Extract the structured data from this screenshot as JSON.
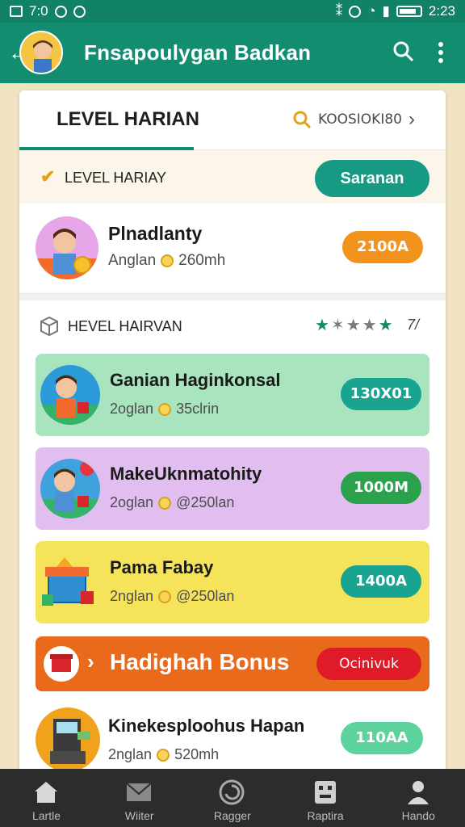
{
  "status_bar": {
    "time_left": "7:0",
    "time_right": "2:23"
  },
  "app_bar": {
    "title": "Fnsapoulygan Badkan"
  },
  "tabs": {
    "active": "LEVEL HARIAN",
    "search_text": "KOOSIOKI80"
  },
  "level_row": {
    "label": "LEVEL HARIAY",
    "button": "Saranan"
  },
  "profile_row": {
    "name": "Plnadlanty",
    "sub_prefix": "Anglan",
    "sub_suffix": "260mh",
    "pill": "2100A"
  },
  "section2": {
    "label": "HEVEL HAIRVAN",
    "rating": "7/"
  },
  "tasks": [
    {
      "name": "Ganian Haginkonsal",
      "sub_prefix": "2oglan",
      "sub_suffix": "35clrin",
      "pill": "130X01",
      "bg": "#a8e4be",
      "pill_color": "#18a491"
    },
    {
      "name": "MakeUknmatohity",
      "sub_prefix": "2oglan",
      "sub_suffix": "@250lan",
      "pill": "1000M",
      "bg": "#e1bdf0",
      "pill_color": "#2aa24b"
    },
    {
      "name": "Pama Fabay",
      "sub_prefix": "2nglan",
      "sub_suffix": "@250lan",
      "pill": "1400A",
      "bg": "#f5e45a",
      "pill_color": "#18a491"
    }
  ],
  "bonus": {
    "title": "Hadighah Bonus",
    "button": "Ocinivuk"
  },
  "last_row": {
    "name": "Kinekesploohus Hapan",
    "sub_prefix": "2nglan",
    "sub_suffix": "520mh",
    "pill": "110AA",
    "pill_color": "#5dd29d"
  },
  "bottom_nav": [
    {
      "label": "Lartle",
      "icon": "home-icon"
    },
    {
      "label": "Wiiter",
      "icon": "mail-icon"
    },
    {
      "label": "Ragger",
      "icon": "swirl-icon"
    },
    {
      "label": "Raptira",
      "icon": "robot-icon"
    },
    {
      "label": "Hando",
      "icon": "person-icon"
    }
  ],
  "colors": {
    "primary": "#138d6f",
    "background": "#efe3c2",
    "bonus": "#ea6a1c",
    "orange_pill": "#f1931d"
  }
}
